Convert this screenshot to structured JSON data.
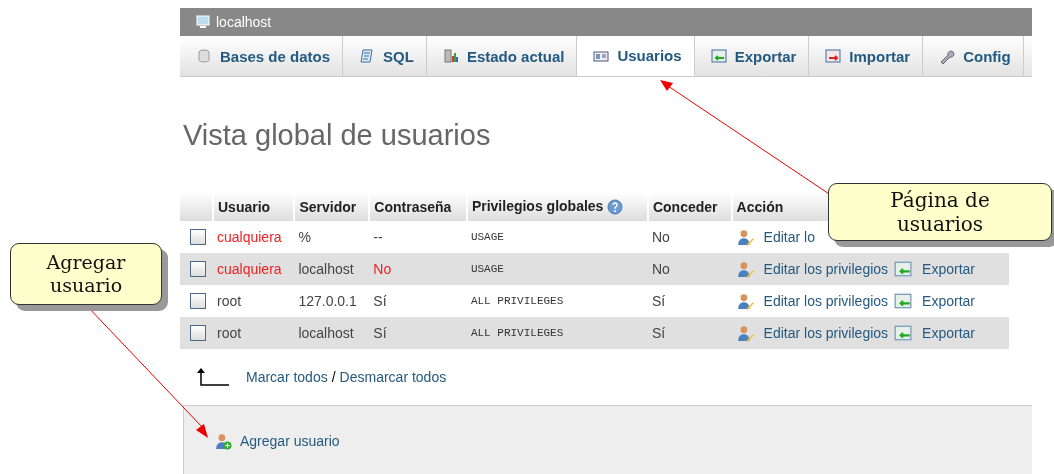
{
  "server_bar": {
    "title": "localhost"
  },
  "tabs": [
    {
      "label": "Bases de datos",
      "kind": "database",
      "selected": false
    },
    {
      "label": "SQL",
      "kind": "sql",
      "selected": false
    },
    {
      "label": "Estado actual",
      "kind": "status",
      "selected": false
    },
    {
      "label": "Usuarios",
      "kind": "users",
      "selected": true
    },
    {
      "label": "Exportar",
      "kind": "export",
      "selected": false
    },
    {
      "label": "Importar",
      "kind": "import",
      "selected": false
    },
    {
      "label": "Config",
      "kind": "settings",
      "selected": false
    }
  ],
  "heading": "Vista global de usuarios",
  "table": {
    "columns": [
      "Usuario",
      "Servidor",
      "Contraseña",
      "Privilegios globales",
      "Conceder",
      "Acción"
    ],
    "rows": [
      {
        "checked": false,
        "user": "cualquiera",
        "user_alert": true,
        "host": "%",
        "password": "--",
        "password_alert": false,
        "privileges": "USAGE",
        "grant": "No",
        "actions": [
          {
            "kind": "edit",
            "label": "Editar lo"
          }
        ]
      },
      {
        "checked": false,
        "user": "cualquiera",
        "user_alert": true,
        "host": "localhost",
        "password": "No",
        "password_alert": true,
        "privileges": "USAGE",
        "grant": "No",
        "actions": [
          {
            "kind": "edit",
            "label": "Editar los privilegios"
          },
          {
            "kind": "export",
            "label": "Exportar"
          }
        ]
      },
      {
        "checked": false,
        "user": "root",
        "user_alert": false,
        "host": "127.0.0.1",
        "password": "Sí",
        "password_alert": false,
        "privileges": "ALL PRIVILEGES",
        "grant": "Sí",
        "actions": [
          {
            "kind": "edit",
            "label": "Editar los privilegios"
          },
          {
            "kind": "export",
            "label": "Exportar"
          }
        ]
      },
      {
        "checked": false,
        "user": "root",
        "user_alert": false,
        "host": "localhost",
        "password": "Sí",
        "password_alert": false,
        "privileges": "ALL PRIVILEGES",
        "grant": "Sí",
        "actions": [
          {
            "kind": "edit",
            "label": "Editar los privilegios"
          },
          {
            "kind": "export",
            "label": "Exportar"
          }
        ]
      }
    ]
  },
  "select_links": {
    "check_all": "Marcar todos",
    "separator": "/",
    "uncheck_all": "Desmarcar todos"
  },
  "add_user": "Agregar usuario",
  "callouts": [
    {
      "text": "Página de usuarios",
      "kind": "tab"
    },
    {
      "text": "Agregar usuario",
      "kind": "add"
    }
  ]
}
